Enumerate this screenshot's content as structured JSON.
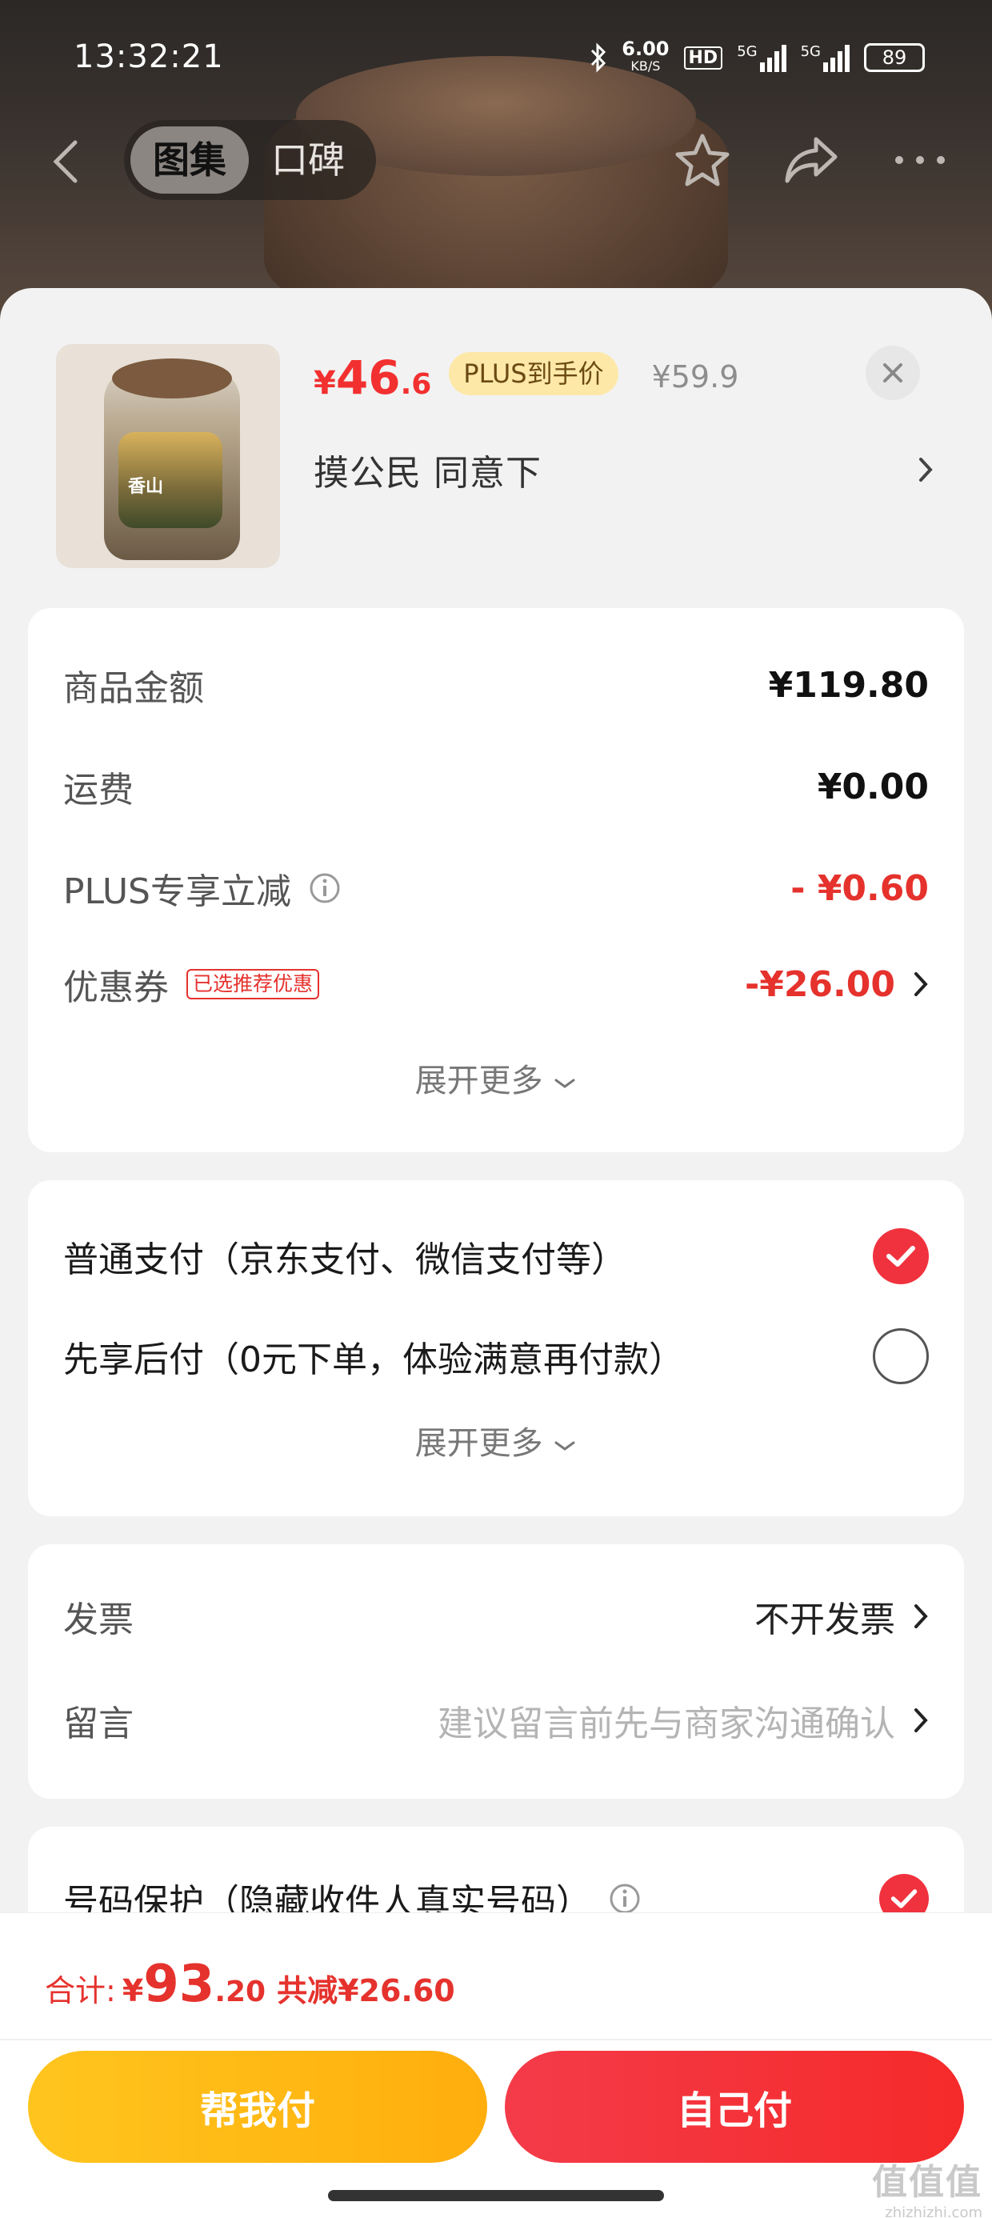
{
  "status_bar": {
    "time": "13:32:21",
    "net_speed": "6.00",
    "net_unit": "KB/S",
    "hd_label": "HD",
    "sig1_label": "5G",
    "sig2_label": "5G",
    "battery": "89"
  },
  "nav": {
    "tab_gallery": "图集",
    "tab_reviews": "口碑"
  },
  "product": {
    "price_currency": "¥",
    "price_int": "46",
    "price_dec": ".6",
    "plus_tag": "PLUS到手价",
    "original_price": "¥59.9",
    "spec": "摸公民  同意下",
    "image_logo_text": "香山"
  },
  "summary": {
    "goods_label": "商品金额",
    "goods_value": "¥119.80",
    "shipping_label": "运费",
    "shipping_value": "¥0.00",
    "plus_discount_label": "PLUS专享立减",
    "plus_discount_value": "- ¥0.60",
    "coupon_label": "优惠券",
    "coupon_tag": "已选推荐优惠",
    "coupon_value": "-¥26.00",
    "expand_label": "展开更多"
  },
  "payment": {
    "option1": "普通支付（京东支付、微信支付等）",
    "option2": "先享后付（0元下单，体验满意再付款）",
    "option1_selected": true,
    "option2_selected": false,
    "expand_label": "展开更多"
  },
  "extras": {
    "invoice_label": "发票",
    "invoice_value": "不开发票",
    "message_label": "留言",
    "message_placeholder": "建议留言前先与商家沟通确认"
  },
  "privacy": {
    "label": "号码保护（隐藏收件人真实号码）",
    "checked": true
  },
  "footer": {
    "total_label": "合计:",
    "total_currency": "¥",
    "total_int": "93",
    "total_dec": ".20",
    "total_discount": "共减¥26.60",
    "help_pay_label": "帮我付",
    "self_pay_label": "自己付"
  },
  "watermark": {
    "line1": "值值值",
    "line2": "zhizhizhi.com"
  },
  "colors": {
    "accent_red": "#e5322d",
    "plus_tag_bg": "#fde8a8",
    "help_btn": "#ffb814",
    "self_btn": "#f43b49"
  }
}
